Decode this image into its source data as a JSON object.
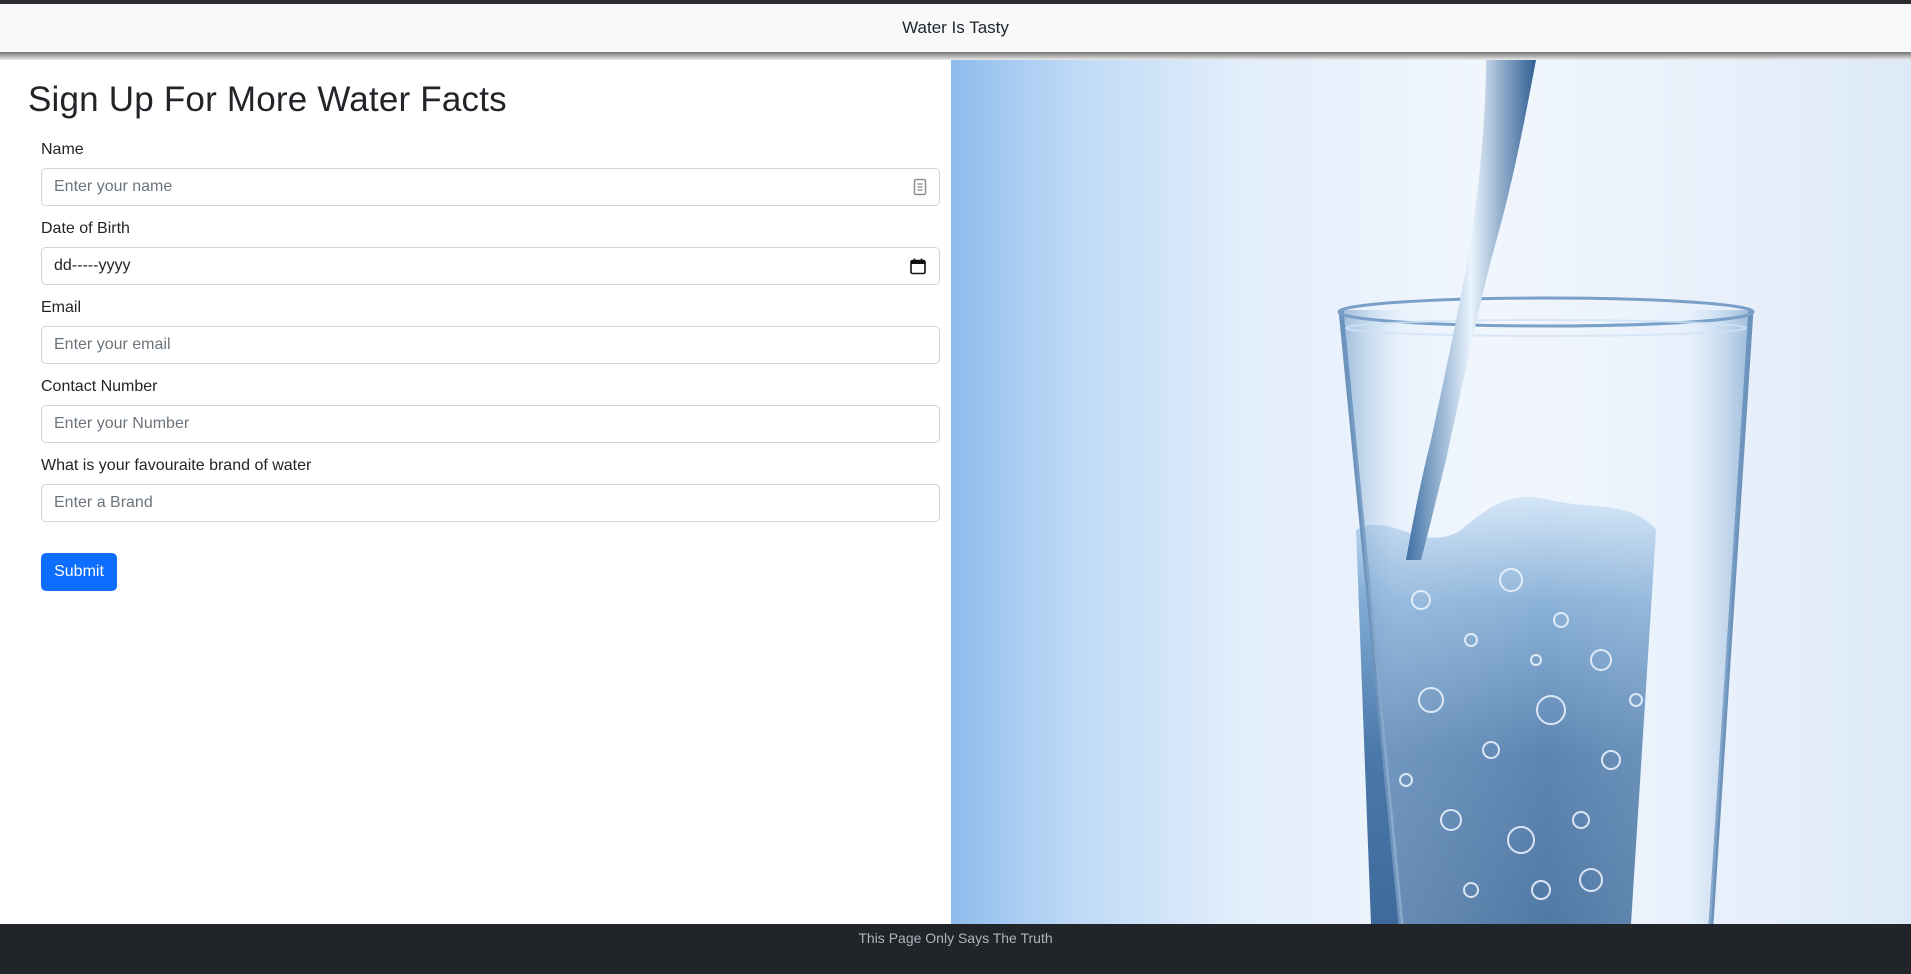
{
  "navbar": {
    "title": "Water Is Tasty"
  },
  "form": {
    "heading": "Sign Up For More Water Facts",
    "fields": [
      {
        "label": "Name",
        "placeholder": "Enter your name",
        "icon": "id-card-icon"
      },
      {
        "label": "Date of Birth",
        "value": "dd-----yyyy",
        "icon": "calendar-icon"
      },
      {
        "label": "Email",
        "placeholder": "Enter your email"
      },
      {
        "label": "Contact Number",
        "placeholder": "Enter your Number"
      },
      {
        "label": "What is your favouraite brand of water",
        "placeholder": "Enter a Brand"
      }
    ],
    "submit_label": "Submit"
  },
  "hero": {
    "image": "water-pouring-into-glass"
  },
  "footer": {
    "text": "This Page Only Says The Truth"
  },
  "colors": {
    "primary": "#0d6efd",
    "navbar_bg": "#f8f9fa",
    "footer_bg": "#212529"
  }
}
